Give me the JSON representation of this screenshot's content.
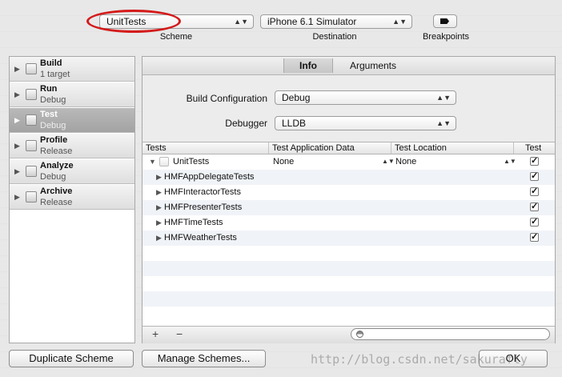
{
  "toolbar": {
    "scheme": {
      "value": "UnitTests",
      "caption": "Scheme"
    },
    "destination": {
      "value": "iPhone 6.1 Simulator",
      "caption": "Destination"
    },
    "breakpoints": {
      "caption": "Breakpoints",
      "icon": "breakpoint-flag-icon"
    },
    "highlight_color": "#d41a1a"
  },
  "actions": [
    {
      "name": "Build",
      "sub": "1 target"
    },
    {
      "name": "Run",
      "sub": "Debug"
    },
    {
      "name": "Test",
      "sub": "Debug",
      "selected": true
    },
    {
      "name": "Profile",
      "sub": "Release"
    },
    {
      "name": "Analyze",
      "sub": "Debug"
    },
    {
      "name": "Archive",
      "sub": "Release"
    }
  ],
  "tabs": {
    "active": "Info",
    "other": "Arguments"
  },
  "info": {
    "build_configuration_label": "Build Configuration",
    "build_configuration_value": "Debug",
    "debugger_label": "Debugger",
    "debugger_value": "LLDB"
  },
  "table": {
    "headers": [
      "Tests",
      "Test Application Data",
      "Test Location",
      "Test"
    ],
    "root": {
      "label": "UnitTests",
      "app_data": "None",
      "location": "None",
      "checked": true
    },
    "children": [
      {
        "label": "HMFAppDelegateTests",
        "checked": true
      },
      {
        "label": "HMFInteractorTests",
        "checked": true
      },
      {
        "label": "HMFPresenterTests",
        "checked": true
      },
      {
        "label": "HMFTimeTests",
        "checked": true
      },
      {
        "label": "HMFWeatherTests",
        "checked": true
      }
    ],
    "add_label": "+",
    "remove_label": "−",
    "check_mark": "✓"
  },
  "buttons": {
    "duplicate": "Duplicate Scheme",
    "manage": "Manage Schemes...",
    "ok": "OK"
  },
  "watermark": "http://blog.csdn.net/sakurafly"
}
